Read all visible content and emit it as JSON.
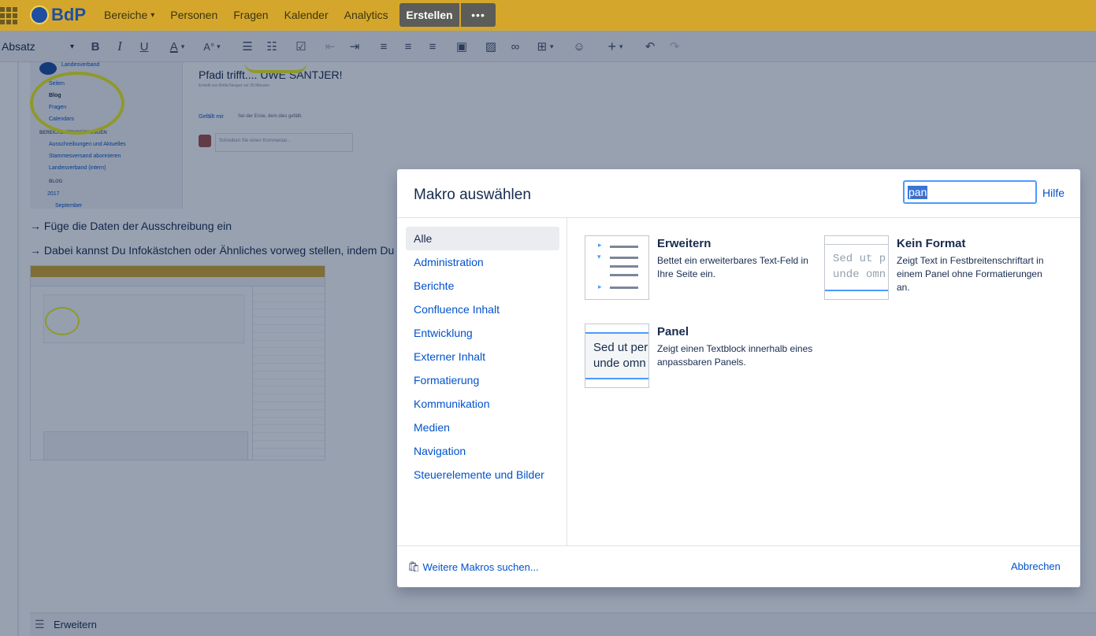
{
  "nav": {
    "logo_text": "BdP",
    "items": [
      {
        "label": "Bereiche",
        "has_chevron": true
      },
      {
        "label": "Personen",
        "has_chevron": false
      },
      {
        "label": "Fragen",
        "has_chevron": false
      },
      {
        "label": "Kalender",
        "has_chevron": false
      },
      {
        "label": "Analytics",
        "has_chevron": false
      }
    ],
    "create_label": "Erstellen",
    "more_label": "•••",
    "colors": {
      "bar": "#d4a72c",
      "create": "#5c5c58"
    }
  },
  "toolbar": {
    "format_label": "Absatz",
    "icons": [
      "bold-icon",
      "italic-icon",
      "underline-icon",
      "text-color-icon",
      "text-style-icon",
      "bullet-list-icon",
      "numbered-list-icon",
      "task-list-icon",
      "outdent-icon",
      "indent-icon",
      "align-left-icon",
      "align-center-icon",
      "align-right-icon",
      "layout-icon",
      "image-icon",
      "link-icon",
      "table-icon",
      "emoji-icon",
      "insert-icon",
      "undo-icon",
      "redo-icon"
    ]
  },
  "content": {
    "shot1": {
      "space_name": "Landesverband",
      "links": [
        "Seiten",
        "Blog",
        "Fragen",
        "Calendars"
      ],
      "section_header": "BEREICHSVERKNÜPFUNGEN",
      "section_links": [
        "Ausschreibungen und Aktuelles",
        "Stammesversand abonnieren",
        "Landesverband (intern)"
      ],
      "blog_header": "BLOG",
      "year": "2017",
      "month": "September",
      "title": "Pfadi trifft.... UWE SANTJER!",
      "meta": "Erstellt von Britta Neuper vor 20 Minuten",
      "like": "Gefällt mir",
      "first_like": "Sei der Erste, dem dies gefällt.",
      "comment_placeholder": "Schreiben Sie einen Kommentar..."
    },
    "para1": "→ Füge die Daten der Ausschreibung ein",
    "para2": "→ Dabei kannst Du Infokästchen oder Ähnliches vorweg stellen, indem Du M",
    "bottom_macro": "Erweitern"
  },
  "dialog": {
    "title": "Makro auswählen",
    "search_value": "pan",
    "help": "Hilfe",
    "categories": [
      {
        "label": "Alle",
        "active": true
      },
      {
        "label": "Administration",
        "active": false
      },
      {
        "label": "Berichte",
        "active": false
      },
      {
        "label": "Confluence Inhalt",
        "active": false
      },
      {
        "label": "Entwicklung",
        "active": false
      },
      {
        "label": "Externer Inhalt",
        "active": false
      },
      {
        "label": "Formatierung",
        "active": false
      },
      {
        "label": "Kommunikation",
        "active": false
      },
      {
        "label": "Medien",
        "active": false
      },
      {
        "label": "Navigation",
        "active": false
      },
      {
        "label": "Steuerelemente und Bilder",
        "active": false
      }
    ],
    "macros": [
      {
        "name": "Erweitern",
        "description": "Bettet ein erweiterbares Text-Feld in Ihre Seite ein.",
        "thumb": "expand-thumbnail"
      },
      {
        "name": "Kein Format",
        "description": "Zeigt Text in Festbreitenschriftart in einem Panel ohne Formatierungen an.",
        "thumb": "noformat-thumbnail",
        "thumb_text": [
          "Sed ut p",
          "unde omn"
        ]
      },
      {
        "name": "Panel",
        "description": "Zeigt einen Textblock innerhalb eines anpassbaren Panels.",
        "thumb": "panel-thumbnail",
        "thumb_text": [
          "Sed ut per",
          "unde omn"
        ]
      }
    ],
    "more_macros": "Weitere Makros suchen...",
    "cancel": "Abbrechen"
  }
}
